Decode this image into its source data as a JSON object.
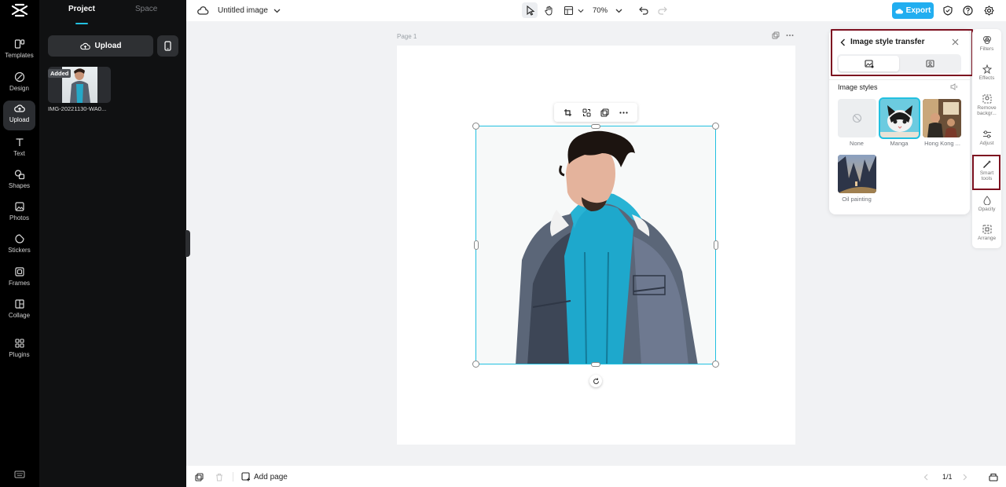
{
  "left_rail": {
    "items": [
      {
        "label": "Templates",
        "icon": "templates-icon"
      },
      {
        "label": "Design",
        "icon": "design-icon"
      },
      {
        "label": "Upload",
        "icon": "upload-cloud-icon",
        "active": true
      },
      {
        "label": "Text",
        "icon": "text-icon"
      },
      {
        "label": "Shapes",
        "icon": "shapes-icon"
      },
      {
        "label": "Photos",
        "icon": "photos-icon"
      },
      {
        "label": "Stickers",
        "icon": "stickers-icon"
      },
      {
        "label": "Frames",
        "icon": "frames-icon"
      },
      {
        "label": "Collage",
        "icon": "collage-icon"
      },
      {
        "label": "Plugins",
        "icon": "plugins-icon"
      }
    ]
  },
  "project_panel": {
    "tabs": [
      "Project",
      "Space"
    ],
    "active_tab": "Project",
    "upload_label": "Upload",
    "asset": {
      "tag": "Added",
      "name": "IMG-20221130-WA0..."
    }
  },
  "topbar": {
    "doc_title": "Untitled image",
    "zoom": "70%",
    "export_label": "Export",
    "accent_color": "#22aef0"
  },
  "canvas": {
    "page_label": "Page 1"
  },
  "style_panel": {
    "title": "Image style transfer",
    "section_title": "Image styles",
    "styles": [
      {
        "label": "None",
        "selected": false
      },
      {
        "label": "Manga",
        "selected": true
      },
      {
        "label": "Hong Kong ...",
        "selected": false
      },
      {
        "label": "Oil painting",
        "selected": false
      }
    ],
    "highlight_color": "#7d1120",
    "selection_color": "#22c0e0"
  },
  "right_tools": {
    "items": [
      {
        "label": "Filters",
        "icon": "filters-icon"
      },
      {
        "label": "Effects",
        "icon": "effects-icon"
      },
      {
        "label": "Remove backgr...",
        "icon": "remove-background-icon"
      },
      {
        "label": "Adjust",
        "icon": "adjust-icon"
      },
      {
        "label": "Smart tools",
        "icon": "smart-tools-icon"
      },
      {
        "label": "Opacity",
        "icon": "opacity-icon"
      },
      {
        "label": "Arrange",
        "icon": "arrange-icon"
      }
    ]
  },
  "bottombar": {
    "add_page_label": "Add page",
    "page_count": "1/1"
  }
}
